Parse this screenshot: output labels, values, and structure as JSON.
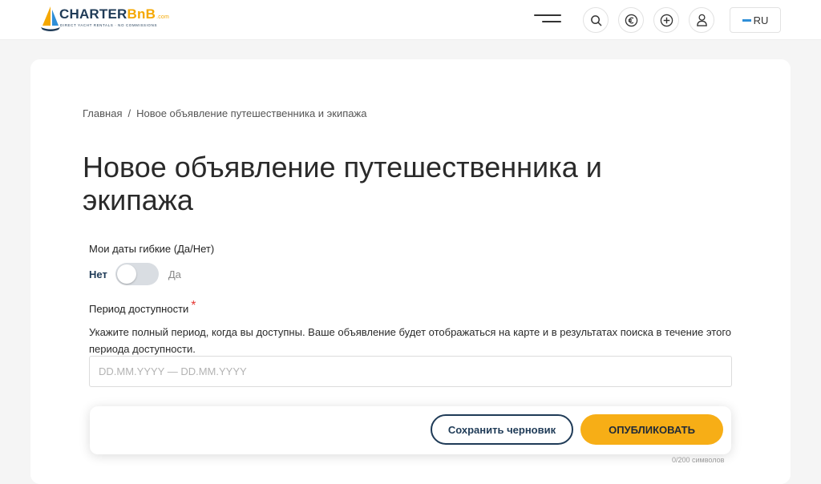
{
  "header": {
    "logo": {
      "brand_main": "CHARTER",
      "brand_accent": "BnB",
      "brand_suffix": ".com",
      "tagline": "DIRECT YACHT RENTALS · NO COMMISSIONS"
    },
    "lang_label": "RU",
    "icons": [
      "menu-icon",
      "search-icon",
      "euro-icon",
      "plus-icon",
      "user-icon"
    ]
  },
  "breadcrumb": {
    "home": "Главная",
    "separator": "/",
    "current": "Новое объявление путешественника и экипажа"
  },
  "page": {
    "title": "Новое объявление путешественника и экипажа"
  },
  "form": {
    "flexible_dates": {
      "label": "Мои даты гибкие (Да/Нет)",
      "off_label": "Нет",
      "on_label": "Да",
      "value": false
    },
    "availability": {
      "label": "Период доступности",
      "required_mark": "*",
      "help": "Укажите полный период, когда вы доступны. Ваше объявление будет отображаться на карте и в результатах поиска в течение этого периода доступности.",
      "placeholder": "DD.MM.YYYY — DD.MM.YYYY",
      "value": ""
    }
  },
  "actions": {
    "save_draft": "Сохранить черновик",
    "publish": "ОПУБЛИКОВАТЬ"
  },
  "counter_text": "0/200 символов",
  "colors": {
    "navy": "#1f3b57",
    "accent": "#f7ae16",
    "required": "#e53935"
  }
}
